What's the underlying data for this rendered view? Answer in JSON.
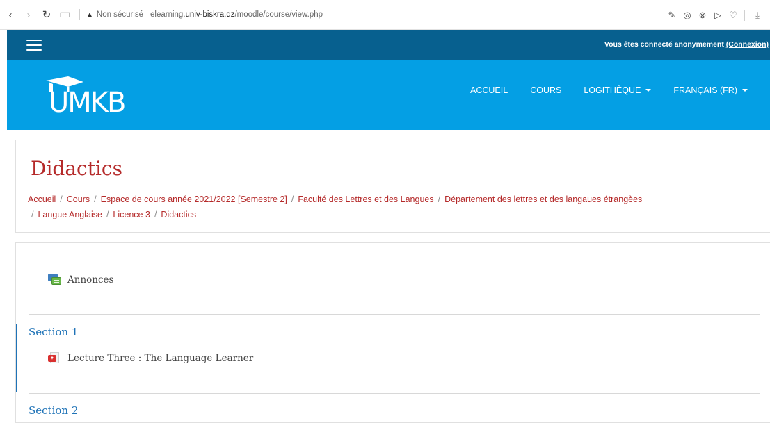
{
  "browser": {
    "security_label": "Non sécurisé",
    "url_prefix": "elearning.",
    "url_host": "univ-biskra.dz",
    "url_path": "/moodle/course/view.php"
  },
  "topbar": {
    "login_text": "Vous êtes connecté anonymement",
    "login_link": "(Connexion)"
  },
  "logo": {
    "text": "UMKB"
  },
  "nav": {
    "items": [
      {
        "label": "ACCUEIL",
        "dropdown": false
      },
      {
        "label": "COURS",
        "dropdown": false
      },
      {
        "label": "LOGITHÈQUE",
        "dropdown": true
      },
      {
        "label": "FRANÇAIS (FR)",
        "dropdown": true
      }
    ]
  },
  "course": {
    "title": "Didactics",
    "breadcrumb": [
      "Accueil",
      "Cours",
      "Espace de cours année 2021/2022 [Semestre 2]",
      "Faculté des Lettres et des Langues",
      "Département des lettres et des langaues étrangèes",
      "Langue Anglaise",
      "Licence 3",
      "Didactics"
    ]
  },
  "content": {
    "announcements": "Annonces",
    "sections": [
      {
        "title": "Section 1",
        "activities": [
          "Lecture Three : The Language Learner"
        ]
      },
      {
        "title": "Section 2",
        "activities": []
      }
    ]
  },
  "colors": {
    "topbar": "#07608f",
    "navbar": "#049fe4",
    "title": "#b52a2a",
    "section": "#1f73b7"
  }
}
